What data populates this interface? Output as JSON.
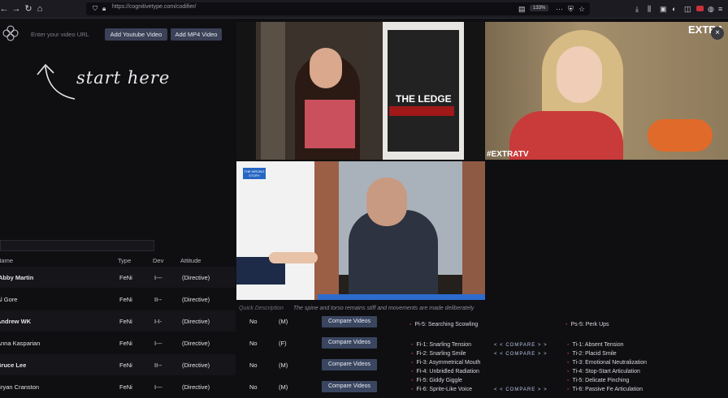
{
  "browser": {
    "url": "https://cognitivetype.com/codifier/",
    "zoom": "133%"
  },
  "header": {
    "url_placeholder": "Enter your video URL",
    "add_youtube": "Add Youtube Video",
    "add_mp4": "Add MP4 Video"
  },
  "hint": {
    "start_here": "start here"
  },
  "videos": {
    "v1_poster_text": "THE LEDGE",
    "v2_watermark": "EXTRA",
    "v2_hashtag": "#EXTRATV",
    "v3_badge": "THE WRONG STORY"
  },
  "description": {
    "label": "Quick Description",
    "text": "The spine and torso remains stiff and movements are made deliberately"
  },
  "table": {
    "headers": {
      "name": "Name",
      "type": "Type",
      "dev": "Dev",
      "attitude": "Attitude"
    },
    "rows": [
      {
        "name": "Abby Martin",
        "type": "FeNi",
        "dev": "I---",
        "attitude": "(Directive)",
        "x": "",
        "y": ""
      },
      {
        "name": "Al Gore",
        "type": "FeNi",
        "dev": "II--",
        "attitude": "(Directive)",
        "x": "",
        "y": ""
      },
      {
        "name": "Andrew WK",
        "type": "FeNi",
        "dev": "I-I-",
        "attitude": "(Directive)",
        "x": "No",
        "y": "(M)"
      },
      {
        "name": "Anna Kasparian",
        "type": "FeNi",
        "dev": "I---",
        "attitude": "(Directive)",
        "x": "No",
        "y": "(F)"
      },
      {
        "name": "Bruce Lee",
        "type": "FeNi",
        "dev": "II--",
        "attitude": "(Directive)",
        "x": "No",
        "y": "(M)"
      },
      {
        "name": "Bryan Cranston",
        "type": "FeNi",
        "dev": "I---",
        "attitude": "(Directive)",
        "x": "No",
        "y": "(M)"
      }
    ],
    "compare_label": "Compare Videos"
  },
  "traits": {
    "top_left": "Pi-5: Searching Scowling",
    "top_right": "Ps-5: Perk Ups",
    "compare_label": "< < COMPARE > >",
    "left": [
      "Fi-1: Snarling Tension",
      "Fi-2: Snarling Smile",
      "Fi-3: Asymmetrical Mouth",
      "Fi-4: Unbridled Radiation",
      "Fi-5: Giddy Giggle",
      "Fi-6: Sprite-Like Voice"
    ],
    "right": [
      "Ti-1: Absent Tension",
      "Ti-2: Placid Smile",
      "Ti-3: Emotional Neutralization",
      "Ti-4: Stop-Start Articulation",
      "Ti-5: Delicate Pinching",
      "Ti-6: Passive Fe Articulation"
    ]
  }
}
